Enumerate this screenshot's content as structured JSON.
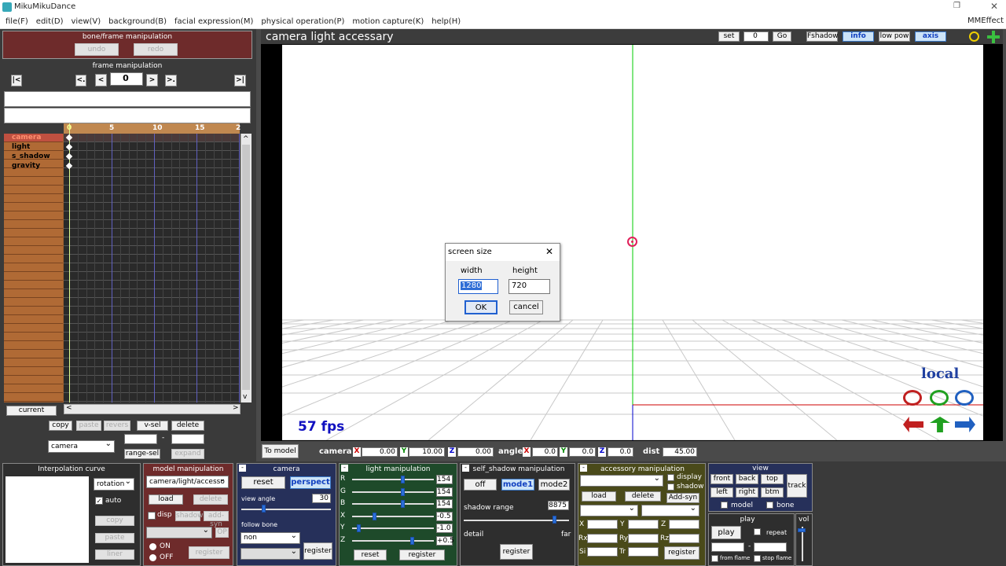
{
  "window": {
    "title": "MikuMikuDance",
    "right_title": "MMEffect",
    "restore": "❐",
    "close": "✕"
  },
  "menu": [
    "file(F)",
    "edit(D)",
    "view(V)",
    "background(B)",
    "facial expression(M)",
    "physical operation(P)",
    "motion capture(K)",
    "help(H)"
  ],
  "bone_frame": {
    "title": "bone/frame manipulation",
    "undo": "undo",
    "redo": "redo"
  },
  "frame_manip": {
    "title": "frame manipulation",
    "first": "|<",
    "prev_key": "<.",
    "prev": "<",
    "frame": "0",
    "next": ">",
    "next_key": ">.",
    "last": ">|"
  },
  "timeline": {
    "ruler": [
      "0",
      "5",
      "10",
      "15",
      "2"
    ],
    "tracks": [
      "camera",
      "light",
      "s_shadow",
      "gravity"
    ],
    "current": "current",
    "scroll_left": "<",
    "scroll_right": ">",
    "scroll_up": "^",
    "scroll_down": "v"
  },
  "tl_buttons": {
    "copy": "copy",
    "paste": "paste",
    "revers": "revers",
    "vsel": "v-sel",
    "delete": "delete",
    "range_sel": "range-sel",
    "expand": "expand",
    "camera_select": "camera",
    "dash": "-"
  },
  "viewport": {
    "title": "camera light accessary",
    "set": "set",
    "frame_value": "0",
    "go": "Go",
    "fshadow": "Fshadow",
    "info": "info",
    "low_pow": "low pow",
    "axis": "axis",
    "fps": "57 fps",
    "local": "local"
  },
  "dialog": {
    "title": "screen size",
    "width_label": "width",
    "height_label": "height",
    "width_value": "1280",
    "height_value": "720",
    "ok": "OK",
    "cancel": "cancel",
    "close": "✕"
  },
  "camera_bar": {
    "to_model": "To model",
    "camera": "camera",
    "x_label": "X",
    "x": "0.00",
    "y_label": "Y",
    "y": "10.00",
    "z_label": "Z",
    "z": "0.00",
    "angle": "angle",
    "ax": "0.0",
    "ay": "0.0",
    "az": "0.0",
    "dist": "dist",
    "dist_value": "45.00"
  },
  "interp": {
    "title": "Interpolation curve",
    "rotation": "rotation",
    "auto": "auto",
    "copy": "copy",
    "paste": "paste",
    "liner": "liner"
  },
  "model": {
    "title": "model manipulation",
    "select": "camera/light/accesso",
    "load": "load",
    "delete": "delete",
    "disp": "disp",
    "shadow": "shadow",
    "add_syn": "add-syn",
    "op": "OP",
    "on": "ON",
    "off": "OFF",
    "register": "register"
  },
  "camera_panel": {
    "title": "camera",
    "reset": "reset",
    "perspect": "perspect",
    "view_angle": "view angle",
    "view_angle_value": "30",
    "follow_bone": "follow bone",
    "follow_select": "non",
    "register": "register"
  },
  "light": {
    "title": "light manipulation",
    "labels": [
      "R",
      "G",
      "B",
      "X",
      "Y",
      "Z"
    ],
    "values": [
      "154",
      "154",
      "154",
      "-0.5",
      "-1.0",
      "+0.5"
    ],
    "reset": "reset",
    "register": "register"
  },
  "shadow": {
    "title": "self_shadow manipulation",
    "off": "off",
    "mode1": "mode1",
    "mode2": "mode2",
    "range_label": "shadow range",
    "range_value": "8875",
    "detail": "detail",
    "far": "far",
    "register": "register"
  },
  "accessory": {
    "title": "accessory manipulation",
    "display": "display",
    "shadow": "shadow",
    "load": "load",
    "delete": "delete",
    "add_syn": "Add-syn",
    "x": "X",
    "y": "Y",
    "z": "Z",
    "rx": "Rx",
    "ry": "Ry",
    "rz": "Rz",
    "si": "Si",
    "tr": "Tr",
    "register": "register"
  },
  "view": {
    "title": "view",
    "front": "front",
    "back": "back",
    "top": "top",
    "left": "left",
    "right": "right",
    "btm": "btm",
    "track": "track",
    "model": "model",
    "bone": "bone"
  },
  "play": {
    "title": "play",
    "play": "play",
    "repeat": "repeat",
    "from_flame": "from flame",
    "stop_flame": "stop flame",
    "dash": "-"
  },
  "vol": {
    "title": "vol"
  },
  "colors": {
    "viewport_bg": "#ffffff",
    "y_axis": "#00cc00",
    "x_axis": "#cc0000",
    "fps": "#1010c0"
  }
}
